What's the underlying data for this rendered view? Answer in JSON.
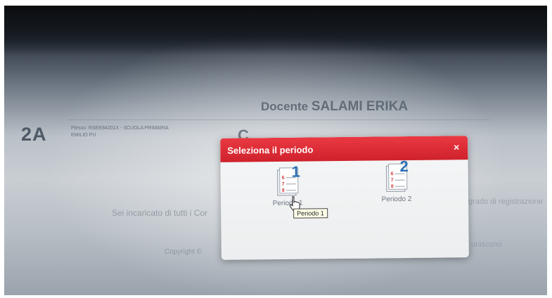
{
  "header": {
    "class_code": "2A",
    "plesso_text": "Plesso: RSEE84201X - SCUOLA PRIMARIA EMILIO PU",
    "teacher_prefix": "Docente",
    "teacher_name": "SALAMI ERIKA",
    "partial_letter": "C"
  },
  "background": {
    "left_text": "Sei incaricato di tutti i Cor",
    "right_text": "grado di registrazione",
    "right_text_2": "uniscono",
    "copyright": "Copyright ©"
  },
  "modal": {
    "title": "Seleziona il periodo",
    "close_glyph": "×",
    "periods": [
      {
        "number": "1",
        "label": "Periodo 1"
      },
      {
        "number": "2",
        "label": "Periodo 2"
      }
    ],
    "tooltip": "Periodo 1",
    "accent_color": "#d92a34"
  }
}
